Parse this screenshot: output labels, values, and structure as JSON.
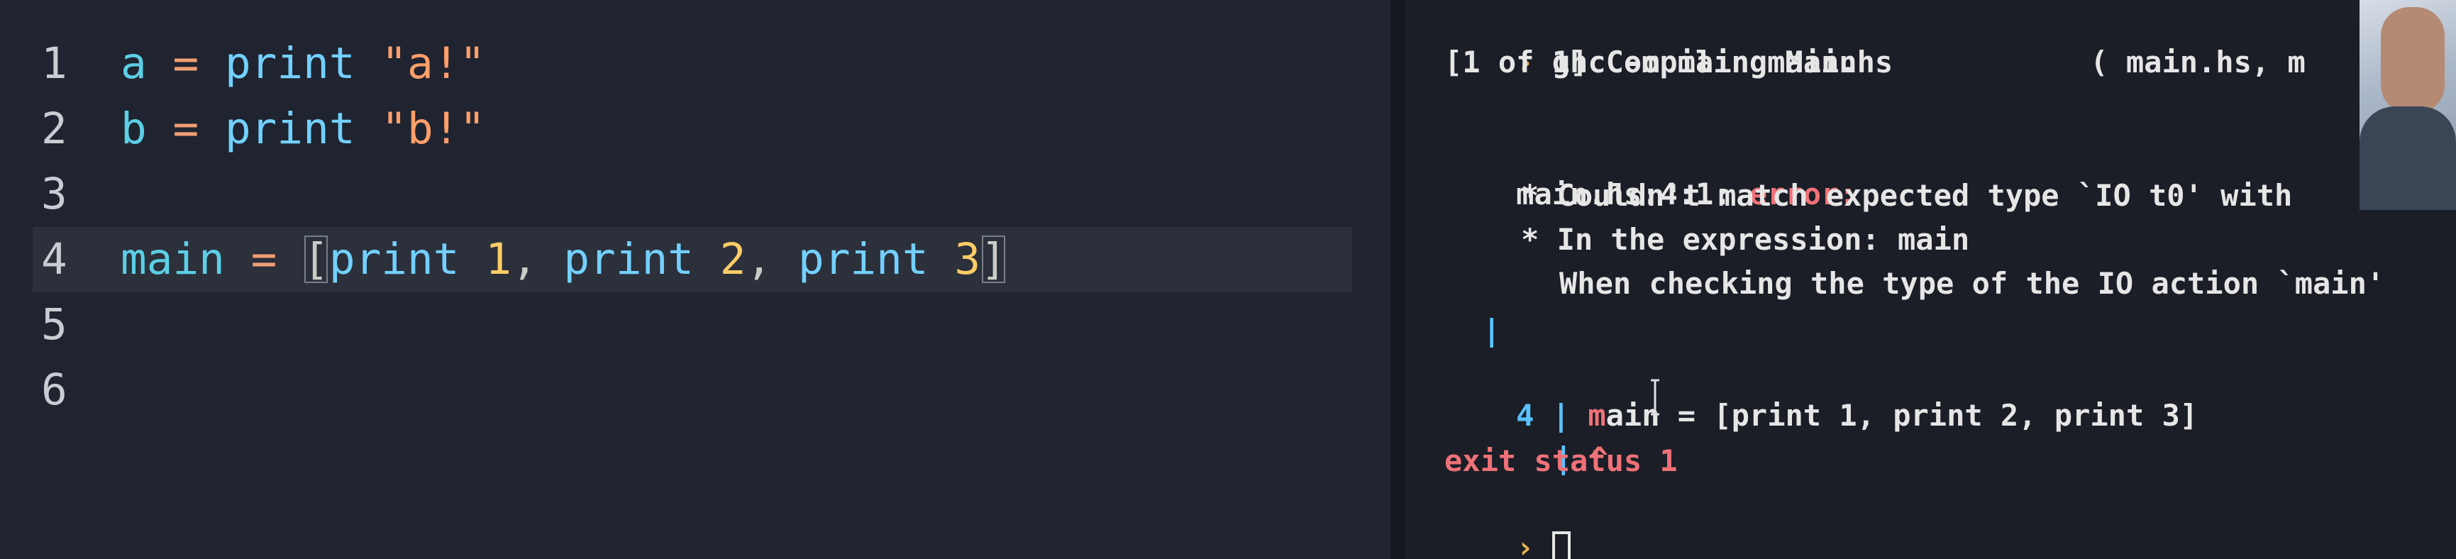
{
  "editor": {
    "lines": [
      {
        "number": "1",
        "tokens": [
          [
            "tok-id",
            "a"
          ],
          [
            "tok-punc",
            " "
          ],
          [
            "tok-op",
            "="
          ],
          [
            "tok-punc",
            " "
          ],
          [
            "tok-fn",
            "print"
          ],
          [
            "tok-punc",
            " "
          ],
          [
            "tok-str",
            "\"a!\""
          ]
        ]
      },
      {
        "number": "2",
        "tokens": [
          [
            "tok-id",
            "b"
          ],
          [
            "tok-punc",
            " "
          ],
          [
            "tok-op",
            "="
          ],
          [
            "tok-punc",
            " "
          ],
          [
            "tok-fn",
            "print"
          ],
          [
            "tok-punc",
            " "
          ],
          [
            "tok-str",
            "\"b!\""
          ]
        ]
      },
      {
        "number": "3",
        "tokens": []
      },
      {
        "number": "4",
        "tokens": [
          [
            "tok-id",
            "main"
          ],
          [
            "tok-punc",
            " "
          ],
          [
            "tok-op",
            "="
          ],
          [
            "tok-punc",
            " "
          ],
          [
            "tok-punc bracket-match",
            "["
          ],
          [
            "tok-fn",
            "print"
          ],
          [
            "tok-punc",
            " "
          ],
          [
            "tok-num",
            "1"
          ],
          [
            "tok-punc",
            ", "
          ],
          [
            "tok-fn",
            "print"
          ],
          [
            "tok-punc",
            " "
          ],
          [
            "tok-num",
            "2"
          ],
          [
            "tok-punc",
            ", "
          ],
          [
            "tok-fn",
            "print"
          ],
          [
            "tok-punc",
            " "
          ],
          [
            "tok-num",
            "3"
          ],
          [
            "tok-punc bracket-match",
            "]"
          ]
        ]
      },
      {
        "number": "5",
        "tokens": []
      },
      {
        "number": "6",
        "tokens": []
      }
    ],
    "current_line": "4"
  },
  "terminal": {
    "prompt_symbol": "›",
    "command": "ghc -o main main.hs",
    "compiling": "[1 of 1] Compiling Main             ( main.hs, m",
    "error_location": "main.hs:4:1:",
    "error_word": "error:",
    "msg1": "* Couldn't match expected type `IO t0' with",
    "msg2": "* In the expression: main",
    "msg3": "When checking the type of the IO action `main'",
    "gutter_bar": "|",
    "gutter_line_no": "4",
    "source_m": "m",
    "source_rest": "ain = [print 1, print 2, print 3]",
    "caret": "^",
    "exit_status": "exit status 1"
  },
  "colors": {
    "editor_bg": "#1f2430",
    "terminal_bg": "#1b1e26",
    "prompt": "#e6b450",
    "error": "#f07178",
    "gutter": "#59c2ff"
  }
}
